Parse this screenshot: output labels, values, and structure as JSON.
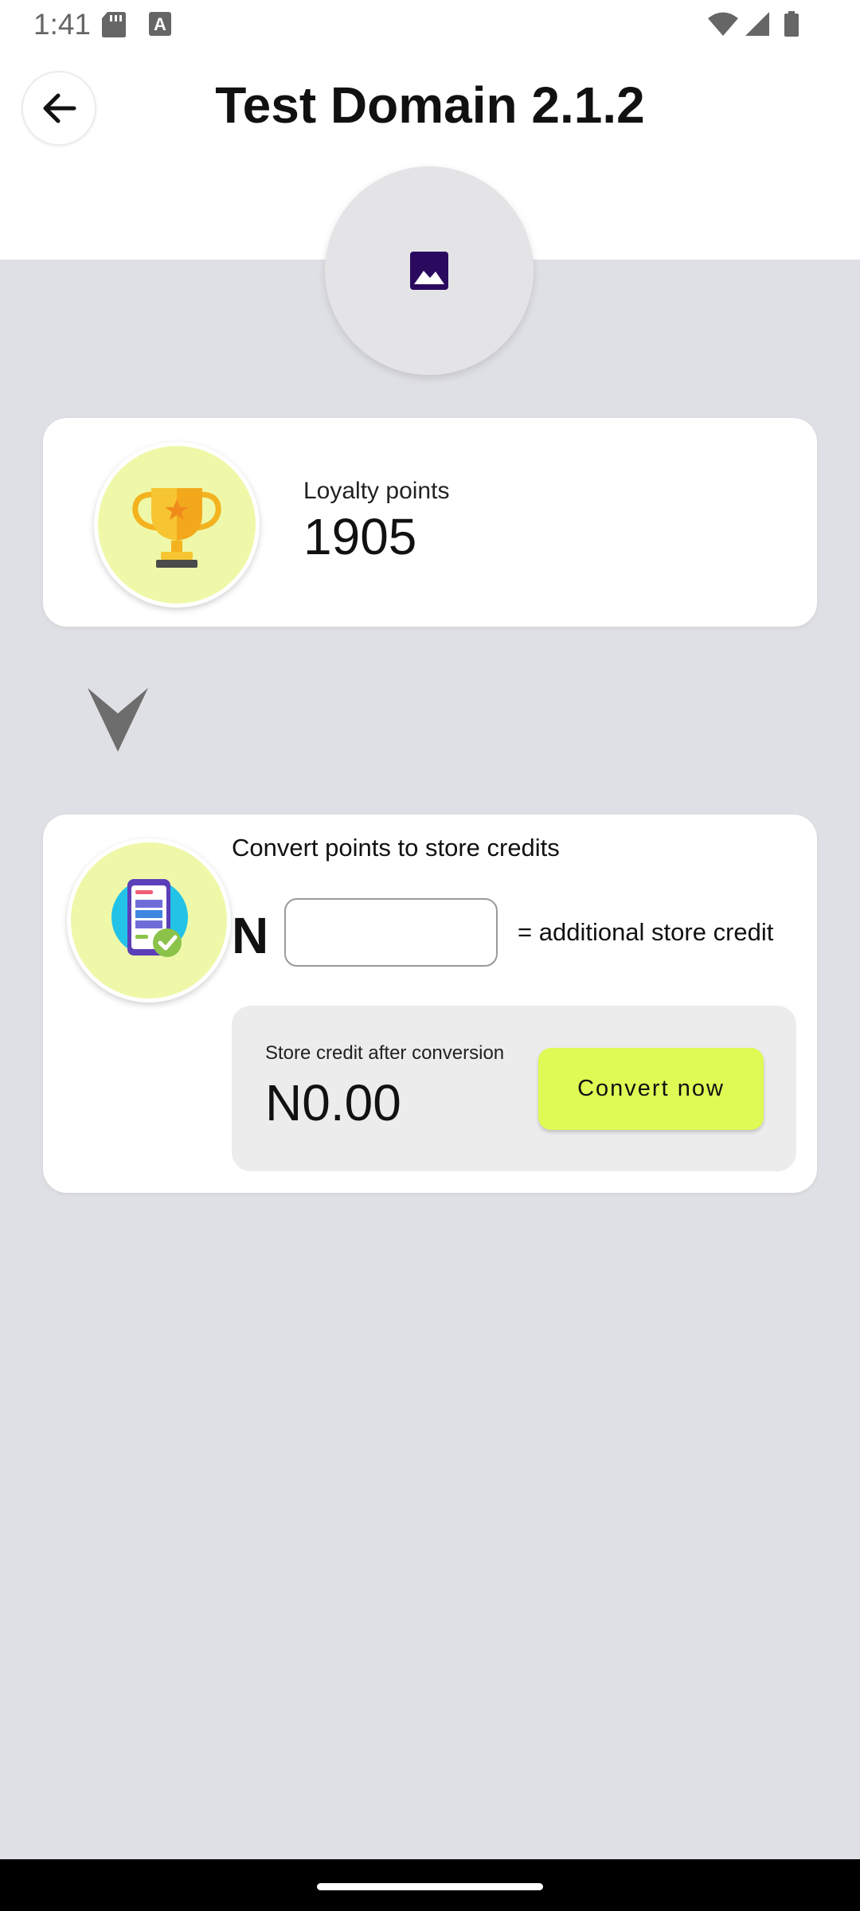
{
  "status_bar": {
    "time": "1:41"
  },
  "header": {
    "title": "Test Domain 2.1.2"
  },
  "loyalty": {
    "label": "Loyalty points",
    "value": "1905"
  },
  "convert": {
    "title": "Convert points to store credits",
    "currency_symbol": "N",
    "input_value": "",
    "additional_label": "= additional store credit",
    "result_label": "Store credit after conversion",
    "result_value": "N0.00",
    "button_label": "Convert now"
  },
  "colors": {
    "accent": "#e0fa55",
    "icon_circle": "#eef8a8",
    "background": "#dfe0e5"
  }
}
